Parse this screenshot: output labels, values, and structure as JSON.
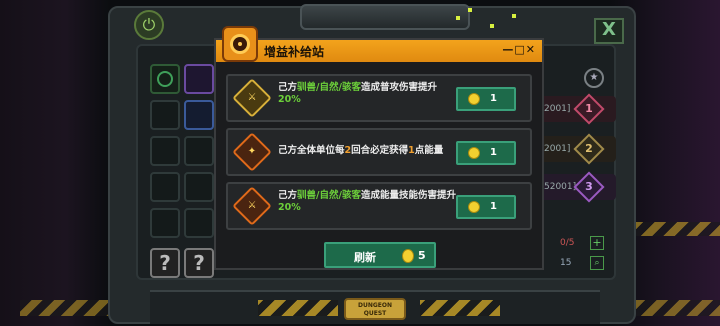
{
  "modal": {
    "title": "增益补给站",
    "window_controls": "—□✕",
    "offers": [
      {
        "parts": [
          {
            "text": "己方",
            "style": "normal"
          },
          {
            "text": "驯兽/自然/骇客",
            "style": "green"
          },
          {
            "text": "造成普攻伤害提升",
            "style": "normal"
          },
          {
            "text": "20%",
            "style": "green"
          }
        ],
        "icon": "sword-buff-icon",
        "price": "1"
      },
      {
        "parts": [
          {
            "text": "己方全体单位每",
            "style": "normal"
          },
          {
            "text": "2",
            "style": "orange"
          },
          {
            "text": "回合必定获得",
            "style": "normal"
          },
          {
            "text": "1",
            "style": "orange"
          },
          {
            "text": "点能量",
            "style": "normal"
          }
        ],
        "icon": "energy-crystal-icon",
        "price": "1"
      },
      {
        "parts": [
          {
            "text": "己方",
            "style": "normal"
          },
          {
            "text": "驯兽/自然/骇客",
            "style": "green"
          },
          {
            "text": "造成能量技能伤害提升",
            "style": "normal"
          },
          {
            "text": "20%",
            "style": "green"
          }
        ],
        "icon": "skill-sword-icon",
        "price": "1"
      }
    ],
    "refresh": {
      "label": "刷新",
      "price": "5"
    }
  },
  "background": {
    "right_rows": [
      "2001]",
      "2001]",
      "52001]"
    ],
    "ranks": [
      "1",
      "2",
      "3"
    ],
    "counter_energy": "0/5",
    "counter_count": "15",
    "brand_line1": "DUNGEON",
    "brand_line2": "QUEST",
    "power_symbol": "⏻",
    "close_symbol": "X",
    "slot_question": "?"
  },
  "colors": {
    "header": "#f3a31c",
    "button": "#1d6a4a",
    "highlight_green": "#6ccf3a",
    "highlight_orange": "#f0a030"
  }
}
